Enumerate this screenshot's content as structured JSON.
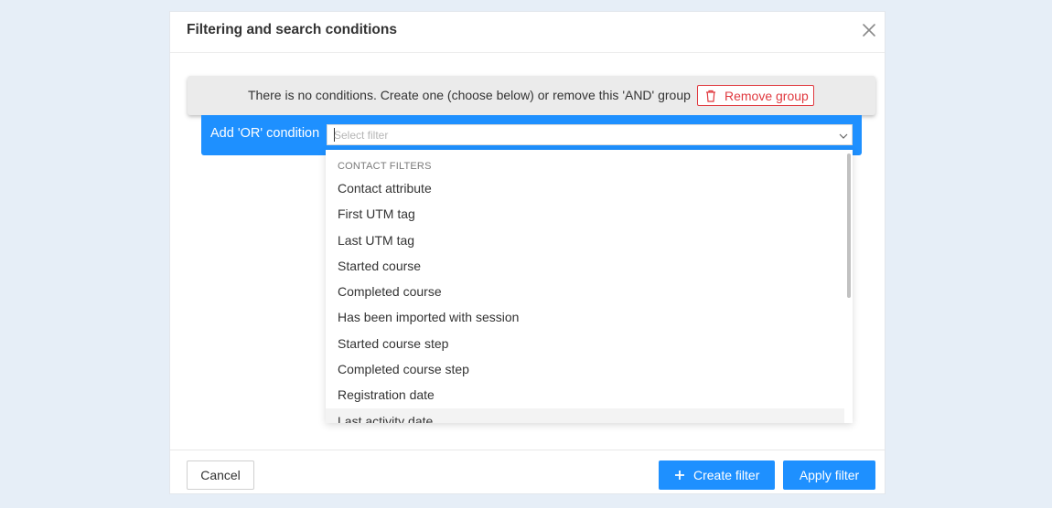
{
  "modal": {
    "title": "Filtering and search conditions"
  },
  "group": {
    "message": "There is no conditions. Create one (choose below) or remove this 'AND' group",
    "remove_label": "Remove group"
  },
  "or_condition": {
    "label": "Add 'OR' condition",
    "select_placeholder": "Select filter"
  },
  "dropdown": {
    "group_title": "CONTACT FILTERS",
    "items": [
      "Contact attribute",
      "First UTM tag",
      "Last UTM tag",
      "Started course",
      "Completed course",
      "Has been imported with session",
      "Started course step",
      "Completed course step",
      "Registration date",
      "Last activity date"
    ],
    "hovered_item": "Last activity date"
  },
  "footer": {
    "cancel_label": "Cancel",
    "create_label": "Create filter",
    "apply_label": "Apply filter"
  },
  "icons": {
    "close": "close-icon",
    "trash": "trash-icon",
    "chevron": "chevron-down-icon",
    "plus": "plus-icon"
  },
  "colors": {
    "accent": "#1e90ff",
    "danger": "#e0393f",
    "background": "#e6eef7"
  }
}
